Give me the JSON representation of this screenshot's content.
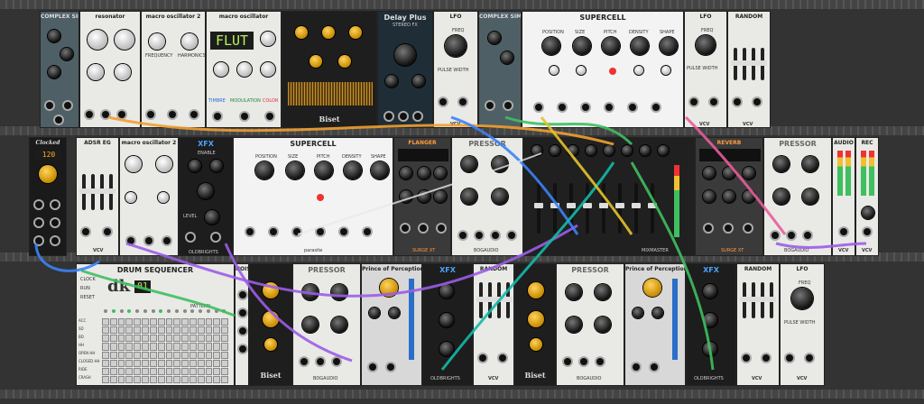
{
  "rack": {
    "rows": 3
  },
  "modules_row1": {
    "complex_simple": {
      "title": "COMPLEX SIMPLE",
      "label_attack": "ATTACK",
      "label_decay": "DECAY"
    },
    "resonator": {
      "title": "resonator"
    },
    "macro_osc_2": {
      "title": "macro oscillator 2",
      "label_freq": "FREQUENCY",
      "label_harm": "HARMONICS"
    },
    "macro_osc": {
      "title": "macro oscillator",
      "display": "FLUT",
      "label_fine": "FINE",
      "label_coarse": "COARSE",
      "label_timbre": "TIMBRE",
      "label_modulation": "MODULATION",
      "label_color": "COLOR"
    },
    "biset": {
      "title": "Biset",
      "label_paste": "PASTE",
      "label_spread": "SPREAD"
    },
    "delay_plus": {
      "title": "Delay Plus",
      "subtitle": "STEREO FX"
    },
    "lfo": {
      "title": "LFO",
      "label_freq": "FREQ",
      "label_pw": "PULSE WIDTH",
      "brand": "VCV"
    },
    "complex_simple_2": {
      "title": "COMPLEX SIMPLE"
    },
    "supercell": {
      "title": "SUPERCELL",
      "labels": [
        "POSITION",
        "SIZE",
        "PITCH",
        "DENSITY",
        "SHAPE"
      ]
    },
    "lfo_2": {
      "title": "LFO",
      "label_freq": "FREQ",
      "label_pw": "PULSE WIDTH",
      "brand": "VCV"
    },
    "random": {
      "title": "RANDOM",
      "labels": [
        "RATE",
        "PROB",
        "RND",
        "SHAPE"
      ],
      "brand": "VCV"
    }
  },
  "modules_row2": {
    "clock": {
      "title": "Clocked",
      "display": "120"
    },
    "adsr": {
      "title": "ADSR EG",
      "brand": "VCV"
    },
    "macro_osc_2": {
      "title": "macro oscillator 2"
    },
    "xfx": {
      "title": "XFX",
      "label_enable": "ENABLE",
      "label_level": "LEVEL",
      "brand": "OLDBRIGHTS"
    },
    "supercell": {
      "title": "SUPERCELL",
      "labels": [
        "POSITION",
        "SIZE",
        "PITCH",
        "DENSITY",
        "SHAPE"
      ],
      "brand": "parasite"
    },
    "flanger": {
      "title": "FLANGER",
      "brand": "SURGE XT"
    },
    "pressor": {
      "title": "PRESSOR",
      "brand": "BOGAUDIO"
    },
    "mixmaster": {
      "title": "MIXMASTER",
      "brand": "MIXMASTER"
    },
    "reverb": {
      "title": "REVERB",
      "brand": "SURGE XT"
    },
    "pressor_2": {
      "title": "PRESSOR",
      "brand": "BOGAUDIO"
    },
    "audio": {
      "title": "AUDIO",
      "brand": "VCV"
    },
    "rec": {
      "title": "REC",
      "brand": "VCV"
    }
  },
  "modules_row3": {
    "drum_seq": {
      "title": "DRUM SEQUENCER",
      "display": "01",
      "logo": "dk",
      "labels": [
        "CLOCK",
        "RUN",
        "RESET",
        "PATTERN"
      ],
      "rows": [
        "ACC",
        "SD",
        "BD",
        "HH",
        "OPEN HH",
        "CLOSED HH",
        "RIDE",
        "CRASH"
      ],
      "active_pattern": [
        0,
        1,
        0,
        1,
        0,
        0,
        0,
        1,
        0,
        0,
        0,
        0,
        0,
        0,
        0,
        0
      ]
    },
    "noise": {
      "title": "NOIS"
    },
    "biset": {
      "title": "Biset"
    },
    "pressor": {
      "title": "PRESSOR",
      "brand": "BOGAUDIO"
    },
    "prince": {
      "title": "Prince of Perception"
    },
    "xfx": {
      "title": "XFX",
      "brand": "OLDBRIGHTS"
    },
    "random": {
      "title": "RANDOM",
      "brand": "VCV"
    },
    "biset_2": {
      "title": "Biset"
    },
    "pressor_2": {
      "title": "PRESSOR",
      "brand": "BOGAUDIO"
    },
    "prince_2": {
      "title": "Prince of Perception"
    },
    "xfx_2": {
      "title": "XFX",
      "brand": "OLDBRIGHTS"
    },
    "random_2": {
      "title": "RANDOM",
      "brand": "VCV"
    },
    "lfo": {
      "title": "LFO",
      "label_freq": "FREQ",
      "label_pw": "PULSE WIDTH",
      "brand": "VCV"
    }
  },
  "colors": {
    "cable_orange": "#f0a030",
    "cable_purple": "#9b5de5",
    "cable_green": "#3fbf5f",
    "cable_blue": "#3b82f6",
    "cable_teal": "#14b8a6",
    "cable_pink": "#e85d9a",
    "cable_white": "#e8e8e8",
    "cable_gold": "#e6c229"
  }
}
